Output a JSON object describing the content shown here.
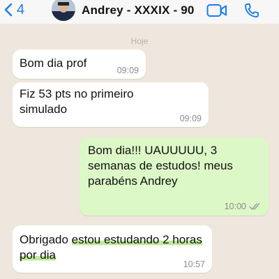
{
  "header": {
    "back_count": "4",
    "contact_name": "Andrey - XXXIX - 90",
    "icons": {
      "back": "chevron-left-icon",
      "video": "video-call-icon",
      "phone": "phone-call-icon"
    },
    "accent_color": "#1a7bf2"
  },
  "chat": {
    "day_label": "Hoje",
    "messages": [
      {
        "direction": "incoming",
        "text": "Bom dia prof",
        "time": "09:09"
      },
      {
        "direction": "incoming",
        "text": "Fiz 53 pts no primeiro simulado",
        "time": "09:09"
      },
      {
        "direction": "outgoing",
        "text": "Bom dia!!! UAUUUUU, 3 semanas de estudos! meus parabéns Andrey",
        "time": "10:00",
        "status": "read"
      },
      {
        "direction": "incoming",
        "text_plain": "Obrigado ",
        "text_highlighted": "estou estudando 2 horas por dia",
        "time": "10:57"
      }
    ],
    "colors": {
      "incoming_bubble": "#ffffff",
      "outgoing_bubble": "#dcf8c6",
      "highlight": "#aae178"
    }
  }
}
